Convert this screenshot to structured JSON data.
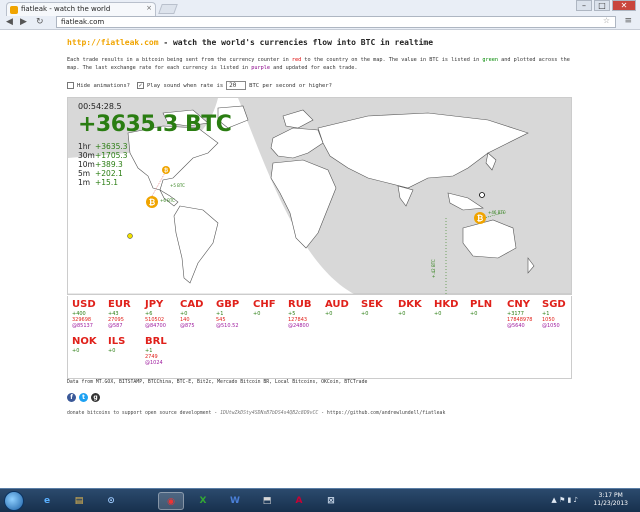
{
  "browser": {
    "tab_title": "fiatleak - watch the world",
    "tab_close": "×",
    "url": "fiatleak.com",
    "star": "☆",
    "menu": "≡",
    "back": "◀",
    "forward": "▶",
    "reload": "↻",
    "win_min": "–",
    "win_max": "□",
    "win_close": "✕"
  },
  "header": {
    "site_url": "http://fiatleak.com",
    "tagline": " - watch the world's currencies flow into BTC in realtime"
  },
  "description": {
    "p1": "Each trade results in a bitcoin being sent from the currency counter in ",
    "red": "red",
    "p2": " to the country on the map. The value in BTC is listed in ",
    "green": "green",
    "p3": " and plotted across the map. The last exchange rate for each currency is listed in ",
    "purple": "purple",
    "p4": " and updated for each trade."
  },
  "controls": {
    "hide_animations": "Hide animations?",
    "play_sound": "Play sound when rate is",
    "rate_value": "20",
    "rate_suffix": "BTC per second or higher?"
  },
  "map": {
    "clock": "00:54:28.5",
    "total": "+3635.3 BTC",
    "stats": [
      {
        "label": "1hr",
        "value": "+3635.3"
      },
      {
        "label": "30m",
        "value": "+1705.3"
      },
      {
        "label": "10m",
        "value": "+389.3"
      },
      {
        "label": "5m",
        "value": "+202.1"
      },
      {
        "label": "1m",
        "value": "+15.1"
      }
    ],
    "labels": {
      "btc_us": "+5 BTC",
      "btc_west": "+6 BTC",
      "btc_aus": "+46 BTC",
      "btc_vertical": "+.42 BTC"
    }
  },
  "currencies": [
    {
      "code": "USD",
      "delta": "+400",
      "amount": "329698",
      "rate": "@85137"
    },
    {
      "code": "EUR",
      "delta": "+43",
      "amount": "27095",
      "rate": "@587"
    },
    {
      "code": "JPY",
      "delta": "+6",
      "amount": "510502",
      "rate": "@84700"
    },
    {
      "code": "CAD",
      "delta": "+0",
      "amount": "140",
      "rate": "@875"
    },
    {
      "code": "GBP",
      "delta": "+1",
      "amount": "545",
      "rate": "@510.52"
    },
    {
      "code": "CHF",
      "delta": "+0",
      "amount": "",
      "rate": ""
    },
    {
      "code": "RUB",
      "delta": "+5",
      "amount": "127843",
      "rate": "@24800"
    },
    {
      "code": "AUD",
      "delta": "+0",
      "amount": "",
      "rate": ""
    },
    {
      "code": "SEK",
      "delta": "+0",
      "amount": "",
      "rate": ""
    },
    {
      "code": "DKK",
      "delta": "+0",
      "amount": "",
      "rate": ""
    },
    {
      "code": "HKD",
      "delta": "+0",
      "amount": "",
      "rate": ""
    },
    {
      "code": "PLN",
      "delta": "+0",
      "amount": "",
      "rate": ""
    },
    {
      "code": "CNY",
      "delta": "+3177",
      "amount": "17848978",
      "rate": "@5640"
    },
    {
      "code": "SGD",
      "delta": "+1",
      "amount": "1050",
      "rate": "@1050"
    },
    {
      "code": "NOK",
      "delta": "+0",
      "amount": "",
      "rate": ""
    },
    {
      "code": "ILS",
      "delta": "+0",
      "amount": "",
      "rate": ""
    },
    {
      "code": "BRL",
      "delta": "+1",
      "amount": "2749",
      "rate": "@1024"
    }
  ],
  "footer": {
    "data_from": "Data from MT.GOX, BITSTAMP, BTCChina, BTC-E, Bit2c, Mercado Bitcoin BR, Local Bitcoins, OKCoin, BTCTrade",
    "donate": "donate bitcoins to support open source development - ",
    "address": "1DUtwZkDSty4SDNsB7bDS4s4QB2c8D9vCC",
    "github": " - https://github.com/andrewlundell/fiatleak",
    "social": [
      "f",
      "t",
      "g"
    ]
  },
  "taskbar": {
    "time": "3:17 PM",
    "date": "11/23/2013",
    "apps": [
      "e",
      "▤",
      "⊙",
      "X",
      "W",
      "⬒",
      "A",
      "⊠"
    ],
    "tray": "▲ ⚑ ▮ ♪"
  },
  "colors": {
    "total_green": "#2a7d12",
    "currency_red": "#e0201a",
    "rate_purple": "#a020a0",
    "bitcoin_orange": "#f0a400"
  }
}
